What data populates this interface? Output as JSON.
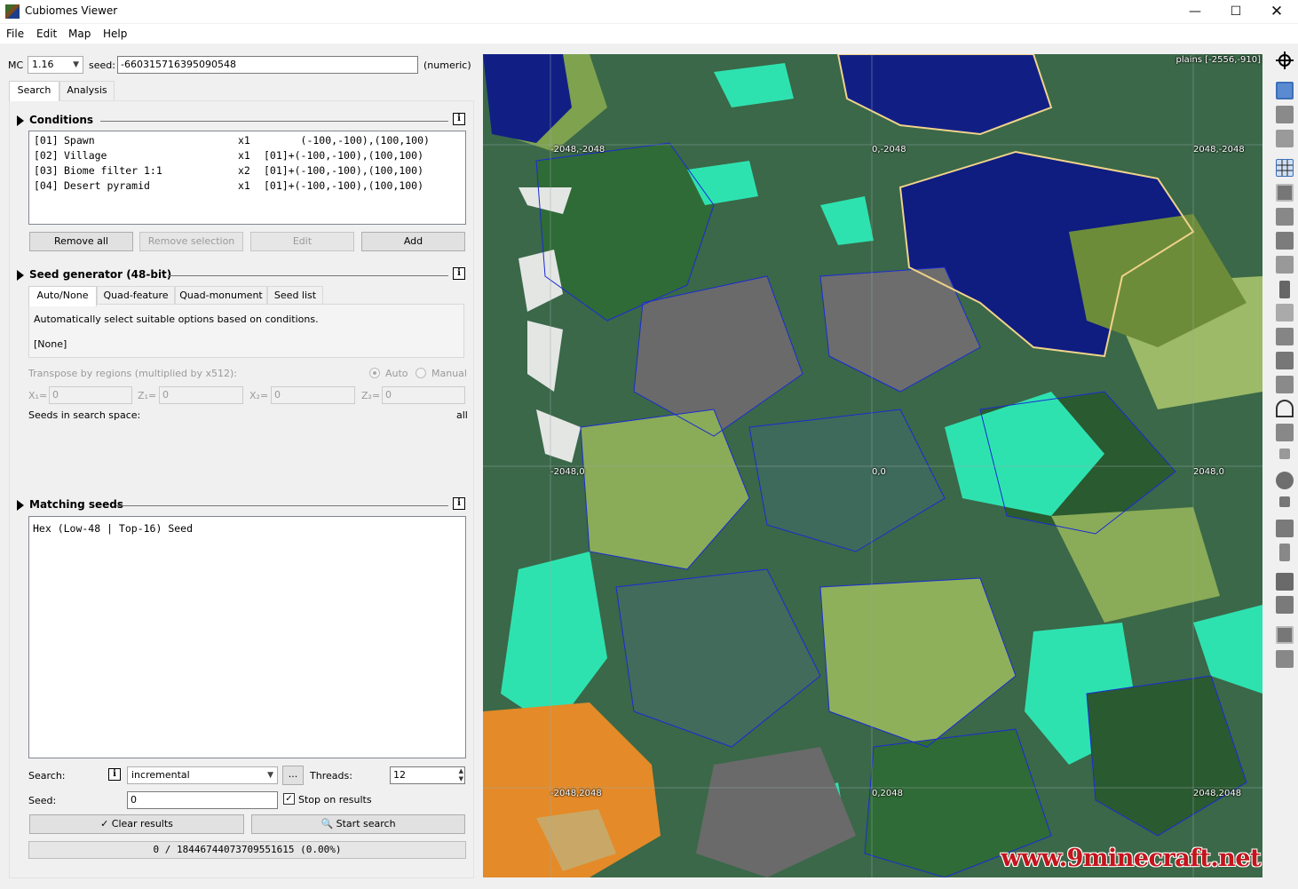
{
  "window": {
    "title": "Cubiomes Viewer",
    "min_glyph": "—",
    "max_glyph": "☐",
    "close_glyph": "✕"
  },
  "menu": [
    "File",
    "Edit",
    "Map",
    "Help"
  ],
  "settings": {
    "mc_label": "MC",
    "mc_version": "1.16",
    "seed_label": "seed:",
    "seed_value": "-660315716395090548",
    "seed_type": "(numeric)"
  },
  "main_tabs": [
    "Search",
    "Analysis"
  ],
  "conditions": {
    "header": "Conditions",
    "rows": [
      {
        "id": "[01]",
        "name": "Spawn",
        "count": "x1",
        "area": "      (-100,-100),(100,100)"
      },
      {
        "id": "[02]",
        "name": "Village",
        "count": "x1",
        "area": "[01]+(-100,-100),(100,100)"
      },
      {
        "id": "[03]",
        "name": "Biome filter 1:1",
        "count": "x2",
        "area": "[01]+(-100,-100),(100,100)"
      },
      {
        "id": "[04]",
        "name": "Desert pyramid",
        "count": "x1",
        "area": "[01]+(-100,-100),(100,100)"
      }
    ],
    "buttons": {
      "remove_all": "Remove all",
      "remove_selection": "Remove selection",
      "edit": "Edit",
      "add": "Add"
    }
  },
  "seed_generator": {
    "header": "Seed generator (48-bit)",
    "tabs": [
      "Auto/None",
      "Quad-feature",
      "Quad-monument",
      "Seed list"
    ],
    "description": "Automatically select suitable options based on conditions.",
    "selection": "[None]",
    "transpose_label": "Transpose by regions (multiplied by x512):",
    "auto_label": "Auto",
    "manual_label": "Manual",
    "x1_label": "X₁=",
    "z1_label": "Z₁=",
    "x2_label": "X₂=",
    "z2_label": "Z₂=",
    "x1": "0",
    "z1": "0",
    "x2": "0",
    "z2": "0",
    "space_label": "Seeds in search space:",
    "space_value": "all"
  },
  "matching": {
    "header": "Matching seeds",
    "columns": "Hex  (Low-48 | Top-16) Seed"
  },
  "search": {
    "search_label": "Search:",
    "mode": "incremental",
    "more": "...",
    "threads_label": "Threads:",
    "threads": "12",
    "seed_label": "Seed:",
    "seed": "0",
    "stop_label": "Stop on results",
    "clear_label": "Clear results",
    "start_label": "Start search",
    "progress": "0 / 18446744073709551615 (0.00%)"
  },
  "map": {
    "hover": "plains [-2556,-910]",
    "coords": [
      "-2048,-2048",
      "0,-2048",
      "2048,-2048",
      "-2048,0",
      "0,0",
      "2048,0",
      "-2048,2048",
      "0,2048",
      "2048,2048"
    ],
    "watermark": "www.9minecraft.net"
  },
  "toolbar": {
    "icons": [
      "crosshair-icon",
      "biomes-icon",
      "height-icon",
      "noise-icon",
      "grid-icon",
      "slime-chunks-icon",
      "village-icon",
      "desert-pyramid-icon",
      "jungle-temple-icon",
      "swamp-hut-icon",
      "igloo-icon",
      "ocean-monument-icon",
      "mansion-icon",
      "ruined-portal-icon",
      "shipwreck-icon",
      "treasure-icon",
      "mineshaft-icon",
      "outpost-icon",
      "stronghold-icon",
      "end-city-icon",
      "gateway-icon",
      "fortress-icon",
      "bastion-icon",
      "spawn-icon",
      "portal-icon"
    ]
  },
  "colors": {
    "accent_blue": "#0000ff",
    "deep_ocean": "#0d1b7a",
    "forest": "#2e6b34",
    "taiga": "#3e6a58",
    "mountains": "#6b6b6b",
    "birch": "#8fb05a",
    "ice_spikes": "#e8e8e8",
    "warm_ocean": "#2ee8b4",
    "badlands": "#e08a2a"
  }
}
